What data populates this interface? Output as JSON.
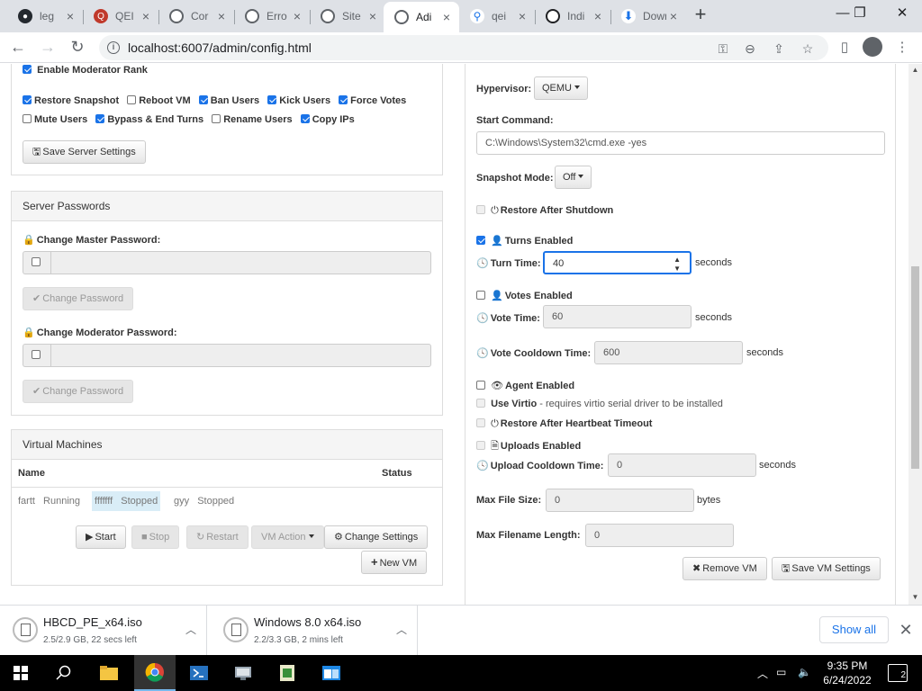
{
  "browser": {
    "tabs": [
      {
        "label": "leg",
        "icon": "github-icon",
        "color": "#24292f"
      },
      {
        "label": "QEI",
        "icon": "qemu-icon",
        "color": "#c0392b"
      },
      {
        "label": "Cor",
        "icon": "globe-icon",
        "color": "#5f6368"
      },
      {
        "label": "Erro",
        "icon": "globe-icon",
        "color": "#5f6368"
      },
      {
        "label": "Site",
        "icon": "globe-icon",
        "color": "#5f6368"
      },
      {
        "label": "Adi",
        "icon": "globe-icon",
        "color": "#5f6368",
        "active": true
      },
      {
        "label": "qei",
        "icon": "search-icon",
        "color": "#1a73e8"
      },
      {
        "label": "Indi",
        "icon": "site-icon",
        "color": "#202124"
      },
      {
        "label": "Downlo",
        "icon": "download-icon",
        "color": "#1a73e8"
      }
    ],
    "url": "localhost:6007/admin/config.html"
  },
  "server_settings": {
    "enable_moderator_rank": "Enable Moderator Rank",
    "perms": {
      "restore_snapshot": "Restore Snapshot",
      "reboot_vm": "Reboot VM",
      "ban_users": "Ban Users",
      "kick_users": "Kick Users",
      "force_votes": "Force Votes",
      "mute_users": "Mute Users",
      "bypass_end_turns": "Bypass & End Turns",
      "rename_users": "Rename Users",
      "copy_ips": "Copy IPs"
    },
    "save_button": "Save Server Settings"
  },
  "server_passwords": {
    "title": "Server Passwords",
    "master_label": "Change Master Password:",
    "moderator_label": "Change Moderator Password:",
    "change_button": "Change Password"
  },
  "virtual_machines": {
    "title": "Virtual Machines",
    "col_name": "Name",
    "col_status": "Status",
    "rows": [
      {
        "name": "fartt",
        "status": "Running",
        "selected": false
      },
      {
        "name": "fffffff",
        "status": "Stopped",
        "selected": true
      },
      {
        "name": "gyy",
        "status": "Stopped",
        "selected": false
      }
    ],
    "buttons": {
      "start": "Start",
      "stop": "Stop",
      "restart": "Restart",
      "vm_action": "VM Action",
      "change_settings": "Change Settings",
      "new_vm": "New VM"
    }
  },
  "vm_settings": {
    "hypervisor_label": "Hypervisor:",
    "hypervisor_value": "QEMU",
    "start_command_label": "Start Command:",
    "start_command_value": "C:\\Windows\\System32\\cmd.exe -yes",
    "snapshot_mode_label": "Snapshot Mode:",
    "snapshot_mode_value": "Off",
    "restore_after_shutdown": "Restore After Shutdown",
    "turns_enabled": "Turns Enabled",
    "turn_time_label": "Turn Time:",
    "turn_time_value": "40",
    "votes_enabled": "Votes Enabled",
    "vote_time_label": "Vote Time:",
    "vote_time_value": "60",
    "vote_cooldown_label": "Vote Cooldown Time:",
    "vote_cooldown_value": "600",
    "agent_enabled": "Agent Enabled",
    "use_virtio": "Use Virtio",
    "use_virtio_note": " - requires virtio serial driver to be installed",
    "restore_after_heartbeat": "Restore After Heartbeat Timeout",
    "uploads_enabled": "Uploads Enabled",
    "upload_cooldown_label": "Upload Cooldown Time:",
    "upload_cooldown_value": "0",
    "max_file_size_label": "Max File Size:",
    "max_file_size_value": "0",
    "max_filename_length_label": "Max Filename Length:",
    "max_filename_length_value": "0",
    "seconds": "seconds",
    "bytes": "bytes",
    "remove_vm": "Remove VM",
    "save_vm_settings": "Save VM Settings"
  },
  "downloads": {
    "items": [
      {
        "name": "HBCD_PE_x64.iso",
        "status": "2.5/2.9 GB, 22 secs left"
      },
      {
        "name": "Windows 8.0 x64.iso",
        "status": "2.2/3.3 GB, 2 mins left"
      }
    ],
    "show_all": "Show all"
  },
  "taskbar": {
    "time": "9:35 PM",
    "date": "6/24/2022",
    "notifications": "2"
  }
}
